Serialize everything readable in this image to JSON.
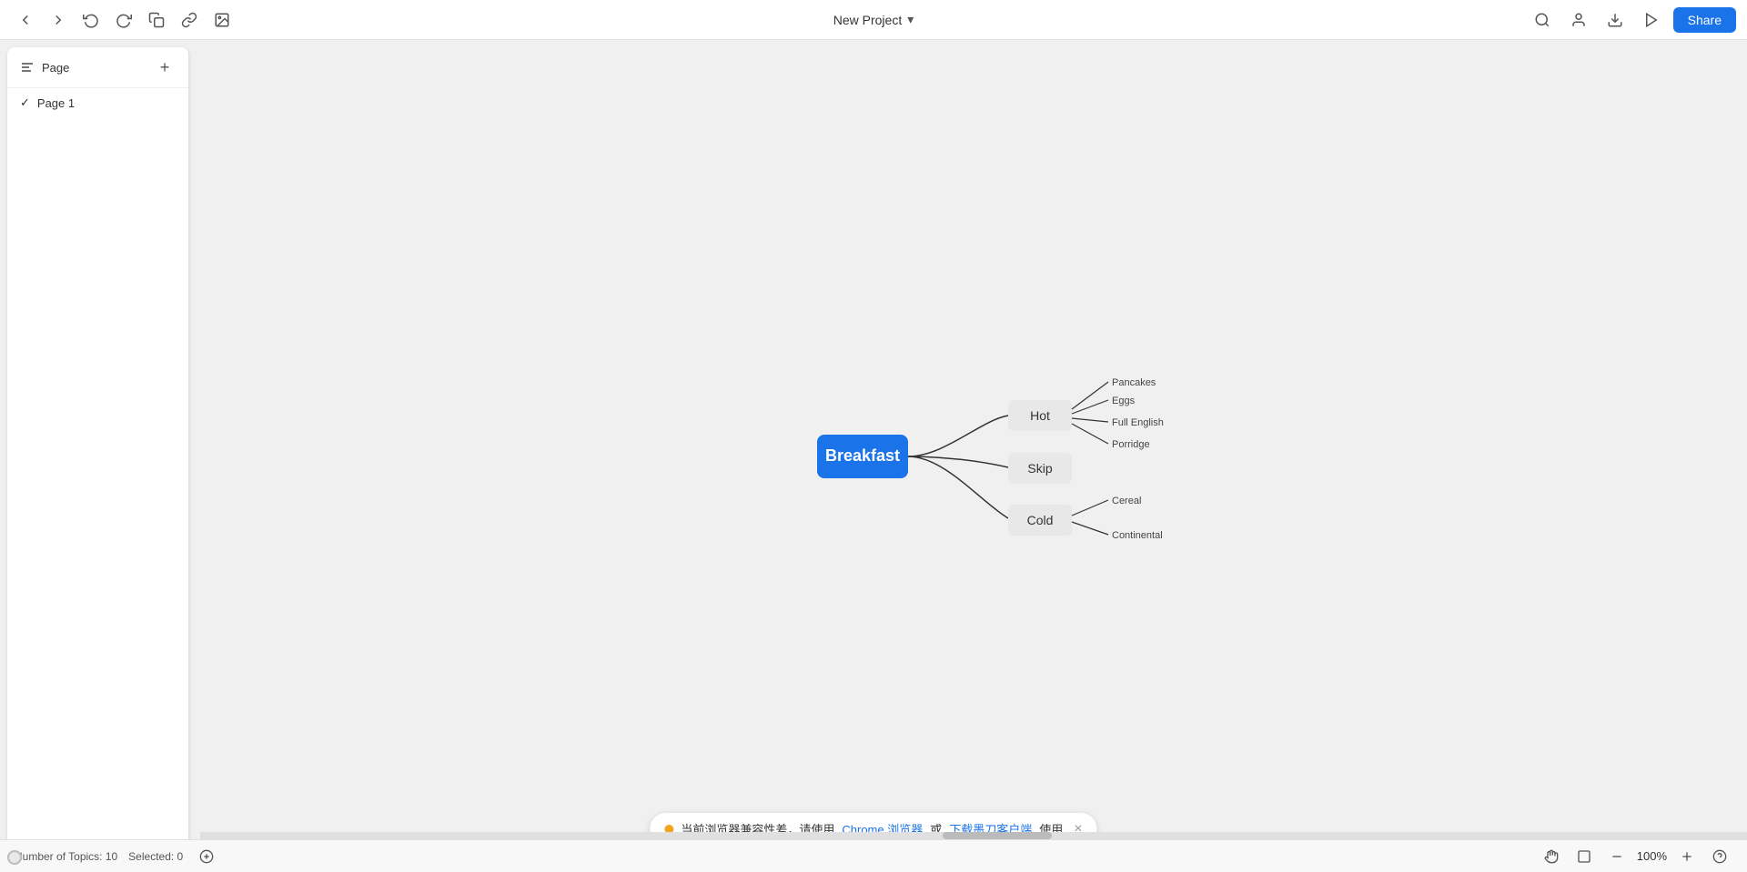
{
  "app": {
    "title": "New Project",
    "dropdown_icon": "▾"
  },
  "toolbar": {
    "back_label": "←",
    "forward_label": "→",
    "undo_label": "↩",
    "redo_label": "↪",
    "copy_label": "⎘",
    "link_label": "🔗",
    "image_label": "🖼",
    "search_label": "🔍",
    "user_label": "👤",
    "download_label": "⬇",
    "play_label": "▶",
    "share_label": "Share"
  },
  "sidebar": {
    "header": "Page",
    "add_label": "+",
    "pages": [
      {
        "name": "Page 1",
        "active": true
      }
    ]
  },
  "mindmap": {
    "central": "Breakfast",
    "branches": [
      {
        "label": "Hot",
        "children": [
          "Pancakes",
          "Eggs",
          "Full English",
          "Porridge"
        ]
      },
      {
        "label": "Skip",
        "children": []
      },
      {
        "label": "Cold",
        "children": [
          "Cereal",
          "Continental"
        ]
      }
    ]
  },
  "notification": {
    "text_before": "当前浏览器兼容性差，请使用",
    "link1": "Chrome 浏览器",
    "text_or": "或",
    "link2": "下载墨刀客户端",
    "text_after": "使用"
  },
  "status_bar": {
    "topics_label": "Number of Topics: 10",
    "selected_label": "Selected: 0",
    "zoom": "100%"
  }
}
